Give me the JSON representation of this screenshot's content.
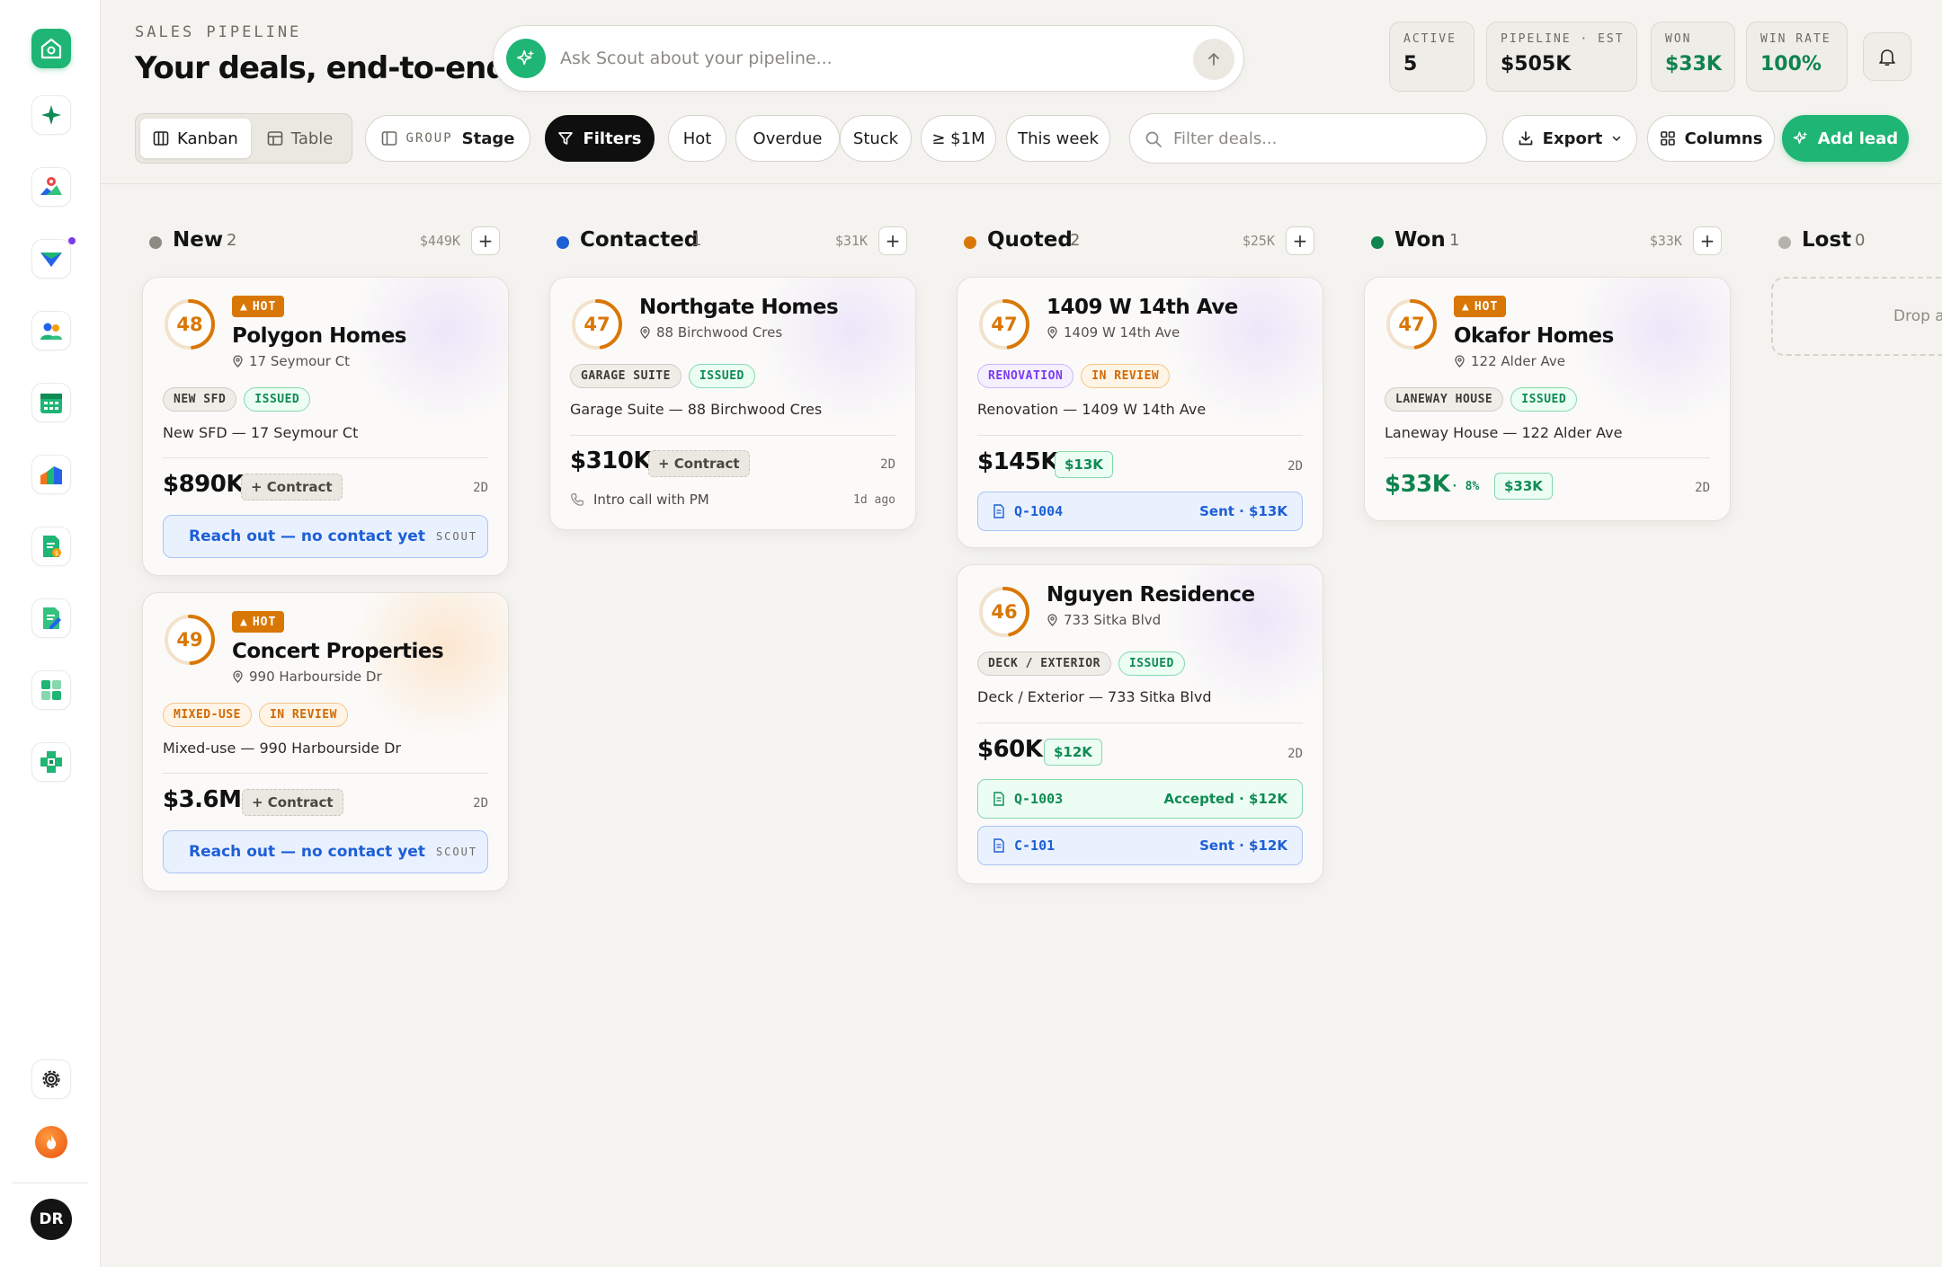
{
  "header": {
    "eyebrow": "SALES PIPELINE",
    "title": "Your deals, end-to-end",
    "ask_placeholder": "Ask Scout about your pipeline..."
  },
  "stats": [
    {
      "label": "ACTIVE",
      "value": "5"
    },
    {
      "label": "PIPELINE · EST",
      "value": "$505K"
    },
    {
      "label": "WON",
      "value": "$33K"
    },
    {
      "label": "WIN RATE",
      "value": "100%"
    }
  ],
  "toolbar": {
    "view_kanban": "Kanban",
    "view_table": "Table",
    "group_label": "GROUP",
    "group_value": "Stage",
    "filters": "Filters",
    "quick_filters": [
      "Hot",
      "Overdue",
      "Stuck",
      "≥ $1M",
      "This week"
    ],
    "search_placeholder": "Filter deals...",
    "export": "Export",
    "columns": "Columns",
    "add_lead": "Add lead"
  },
  "colors": {
    "brand": "#1fb574",
    "new": "#8d8a83",
    "contacted": "#1d5fd6",
    "quoted": "#d97706",
    "won": "#10834f",
    "lost": "#b5b2ab"
  },
  "columns": [
    {
      "name": "New",
      "count": "2",
      "sum": "$449K"
    },
    {
      "name": "Contacted",
      "count": "1",
      "sum": "$31K"
    },
    {
      "name": "Quoted",
      "count": "2",
      "sum": "$25K"
    },
    {
      "name": "Won",
      "count": "1",
      "sum": "$33K"
    },
    {
      "name": "Lost",
      "count": "0",
      "drop_text": "Drop a"
    }
  ],
  "cards": {
    "polygon": {
      "score": "48",
      "hot": "HOT",
      "name": "Polygon Homes",
      "address": "17 Seymour Ct",
      "tags": [
        "NEW SFD",
        "ISSUED"
      ],
      "desc": "New SFD — 17 Seymour Ct",
      "price": "$890K",
      "contract": "+ Contract",
      "age": "2D",
      "action": "Reach out — no contact yet",
      "action_tag": "SCOUT"
    },
    "concert": {
      "score": "49",
      "hot": "HOT",
      "name": "Concert Properties",
      "address": "990 Harbourside Dr",
      "tags": [
        "MIXED-USE",
        "IN REVIEW"
      ],
      "desc": "Mixed-use — 990 Harbourside Dr",
      "price": "$3.6M",
      "contract": "+ Contract",
      "age": "2D",
      "action": "Reach out — no contact yet",
      "action_tag": "SCOUT"
    },
    "northgate": {
      "score": "47",
      "name": "Northgate Homes",
      "address": "88 Birchwood Cres",
      "tags": [
        "GARAGE SUITE",
        "ISSUED"
      ],
      "desc": "Garage Suite — 88 Birchwood Cres",
      "price": "$310K",
      "contract": "+ Contract",
      "age": "2D",
      "note": "Intro call with PM",
      "note_when": "1d ago"
    },
    "w14th": {
      "score": "47",
      "name": "1409 W 14th Ave",
      "address": "1409 W 14th Ave",
      "tags": [
        "RENOVATION",
        "IN REVIEW"
      ],
      "desc": "Renovation — 1409 W 14th Ave",
      "price": "$145K",
      "money": "$13K",
      "age": "2D",
      "doc_id": "Q-1004",
      "doc_status": "Sent · $13K"
    },
    "nguyen": {
      "score": "46",
      "name": "Nguyen Residence",
      "address": "733 Sitka Blvd",
      "tags": [
        "DECK / EXTERIOR",
        "ISSUED"
      ],
      "desc": "Deck / Exterior — 733 Sitka Blvd",
      "price": "$60K",
      "money": "$12K",
      "age": "2D",
      "docs": [
        {
          "id": "Q-1003",
          "status": "Accepted · $12K"
        },
        {
          "id": "C-101",
          "status": "Sent · $12K"
        }
      ]
    },
    "okafor": {
      "score": "47",
      "hot": "HOT",
      "name": "Okafor Homes",
      "address": "122 Alder Ave",
      "tags": [
        "LANEWAY HOUSE",
        "ISSUED"
      ],
      "desc": "Laneway House — 122 Alder Ave",
      "price": "$33K",
      "pct": "· 8%",
      "money": "$33K",
      "age": "2D"
    }
  },
  "user": {
    "initials": "DR"
  }
}
